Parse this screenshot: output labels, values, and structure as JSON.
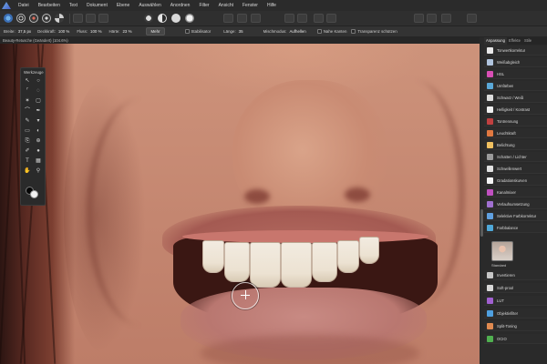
{
  "menu": {
    "items": [
      "Datei",
      "Bearbeiten",
      "Text",
      "Dokument",
      "Ebene",
      "Auswählen",
      "Anordnen",
      "Filter",
      "Ansicht",
      "Fenster",
      "Hilfe"
    ]
  },
  "context_toolbar": {
    "breite_label": "Breite:",
    "breite_value": "37,5 px",
    "deckkraft_label": "Deckkraft:",
    "deckkraft_value": "100 %",
    "fluss_label": "Fluss:",
    "fluss_value": "100 %",
    "haerte_label": "Härte:",
    "haerte_value": "23 %",
    "mehr_button": "Mehr",
    "stabilisator_label": "Stabilisator",
    "laenge_label": "Länge:",
    "laenge_value": "35",
    "mischmodus_label": "Mischmodus:",
    "mischmodus_value": "Aufhellen",
    "nahe_kanten_label": "Nahe Kanten",
    "transparenz_label": "Transparenz schützen"
  },
  "document": {
    "tab_title": "Beauty-Retusche (Geändert) (104.6%)"
  },
  "tools_panel": {
    "title": "Werkzeuge"
  },
  "right_panel": {
    "tabs": [
      "Anpassung",
      "Effekte",
      "Stile"
    ],
    "active_tab": "Anpassung",
    "items": [
      {
        "label": "Tonwertkorrektur",
        "color": "#e8e8e8"
      },
      {
        "label": "Weißabgleich",
        "color": "#b0c4de"
      },
      {
        "label": "HSL",
        "color": "#d94fb5"
      },
      {
        "label": "Umfärben",
        "color": "#5aa8d8"
      },
      {
        "label": "Schwarz / Weiß",
        "color": "#dcdcdc"
      },
      {
        "label": "Helligkeit / Kontrast",
        "color": "#f0f0f0"
      },
      {
        "label": "Tontrennung",
        "color": "#c04040"
      },
      {
        "label": "Leuchtkraft",
        "color": "#e07840"
      },
      {
        "label": "Belichtung",
        "color": "#f0c060"
      },
      {
        "label": "Schatten / Lichter",
        "color": "#9a9a9a"
      },
      {
        "label": "Schwellenwert",
        "color": "#e0e0e0"
      },
      {
        "label": "Gradationskurven",
        "color": "#f4f4f4"
      },
      {
        "label": "Kanalmixer",
        "color": "#c050c0"
      },
      {
        "label": "Verlaufsumsetzung",
        "color": "#a070d0"
      },
      {
        "label": "Selektive Farbkorrektur",
        "color": "#60a0e0"
      },
      {
        "label": "Farbbalance",
        "color": "#4fa8d8"
      }
    ],
    "preset_label": "Standard",
    "items_lower": [
      {
        "label": "Invertieren",
        "color": "#c6c6c6"
      },
      {
        "label": "Soft-proof",
        "color": "#d8d8d8"
      },
      {
        "label": "LUT",
        "color": "#a060d0"
      },
      {
        "label": "Objektivfilter",
        "color": "#4fa0e0"
      },
      {
        "label": "Split-Toning",
        "color": "#e08a50"
      },
      {
        "label": "OCIO",
        "color": "#50b050"
      }
    ]
  },
  "colors": {
    "foreground": "#050505",
    "background": "#f2f2f2"
  }
}
